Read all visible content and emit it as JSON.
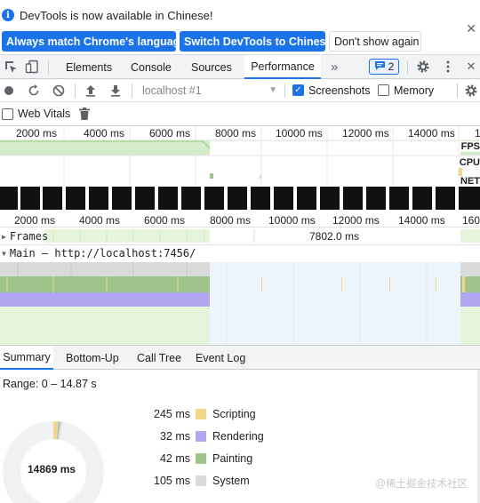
{
  "infobar": {
    "message": "DevTools is now available in Chinese!",
    "btn_match": "Always match Chrome's language",
    "btn_switch": "Switch DevTools to Chinese",
    "btn_dismiss": "Don't show again",
    "close": "✕"
  },
  "tabs": {
    "elements": "Elements",
    "console": "Console",
    "sources": "Sources",
    "performance": "Performance",
    "more": "»",
    "issues_count": "2"
  },
  "toolbar": {
    "target": "localhost #1",
    "screenshots_label": "Screenshots",
    "screenshots_checked": true,
    "memory_label": "Memory",
    "memory_checked": false,
    "webvitals_label": "Web Vitals",
    "webvitals_checked": false
  },
  "overview": {
    "ruler": [
      "2000 ms",
      "4000 ms",
      "6000 ms",
      "8000 ms",
      "10000 ms",
      "12000 ms",
      "14000 ms",
      "1"
    ],
    "fps_label": "FPS",
    "cpu_label": "CPU",
    "net_label": "NET"
  },
  "timeline": {
    "ruler": [
      "2000 ms",
      "4000 ms",
      "6000 ms",
      "8000 ms",
      "10000 ms",
      "12000 ms",
      "14000 ms",
      "160"
    ],
    "frames_label": "Frames",
    "frames_value": "7802.0 ms",
    "main_label": "Main — http://localhost:7456/"
  },
  "bottom_tabs": {
    "summary": "Summary",
    "bottom_up": "Bottom-Up",
    "call_tree": "Call Tree",
    "event_log": "Event Log"
  },
  "summary": {
    "range": "Range: 0 – 14.87 s",
    "total": "14869 ms",
    "items": [
      {
        "ms": "245 ms",
        "name": "Scripting",
        "color": "#f2d78b"
      },
      {
        "ms": "32 ms",
        "name": "Rendering",
        "color": "#b3a6f0"
      },
      {
        "ms": "42 ms",
        "name": "Painting",
        "color": "#9ec48b"
      },
      {
        "ms": "105 ms",
        "name": "System",
        "color": "#dadada"
      }
    ]
  },
  "watermark": "@稀土掘金技术社区",
  "colors": {
    "accent": "#1a73e8",
    "scripting": "#f2d78b",
    "rendering": "#b3a6f0",
    "painting": "#9ec48b",
    "system": "#dadada"
  }
}
